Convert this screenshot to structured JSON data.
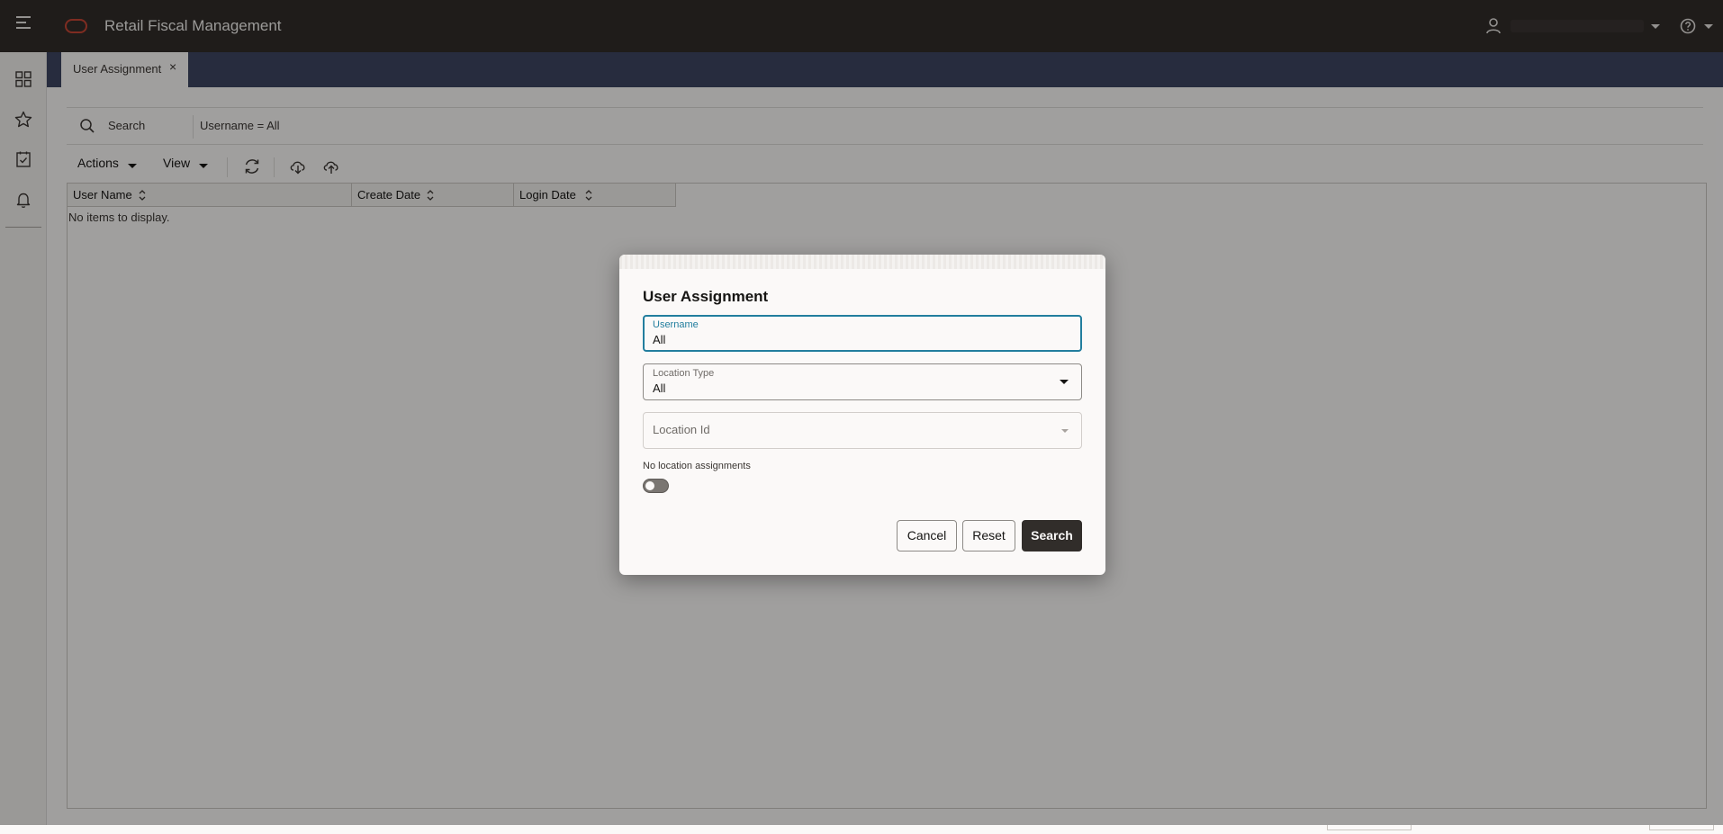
{
  "header": {
    "app_title": "Retail Fiscal Management",
    "menu_icon": "hamburger-menu-icon",
    "logo_icon": "oracle-logo",
    "user_icon": "user-icon",
    "help_icon": "help-icon"
  },
  "sidenav": {
    "items": [
      {
        "icon": "dashboard-grid-icon"
      },
      {
        "icon": "favorites-star-icon"
      },
      {
        "icon": "tasks-checklist-icon"
      },
      {
        "icon": "notifications-bell-icon"
      }
    ]
  },
  "tabs": [
    {
      "label": "User Assignment",
      "close": "×"
    }
  ],
  "search": {
    "label": "Search",
    "criteria": "Username = All"
  },
  "toolbar": {
    "actions_label": "Actions",
    "view_label": "View",
    "icons": [
      "refresh-icon",
      "download-cloud-icon",
      "upload-cloud-icon"
    ]
  },
  "grid": {
    "columns": [
      "User Name",
      "Create Date",
      "Login Date"
    ],
    "empty_message": "No items to display."
  },
  "dialog": {
    "title": "User Assignment",
    "username": {
      "label": "Username",
      "value": "All"
    },
    "location_type": {
      "label": "Location Type",
      "value": "All"
    },
    "location_id": {
      "placeholder": "Location Id"
    },
    "switch_label": "No location assignments",
    "switch_on": false,
    "buttons": {
      "cancel": "Cancel",
      "reset": "Reset",
      "search": "Search"
    }
  },
  "colors": {
    "header_bg": "#312d2a",
    "tabstrip_bg": "#3e4661",
    "accent_focus": "#227e9e",
    "primary_button": "#312d2a",
    "brand_red": "#c74634"
  }
}
